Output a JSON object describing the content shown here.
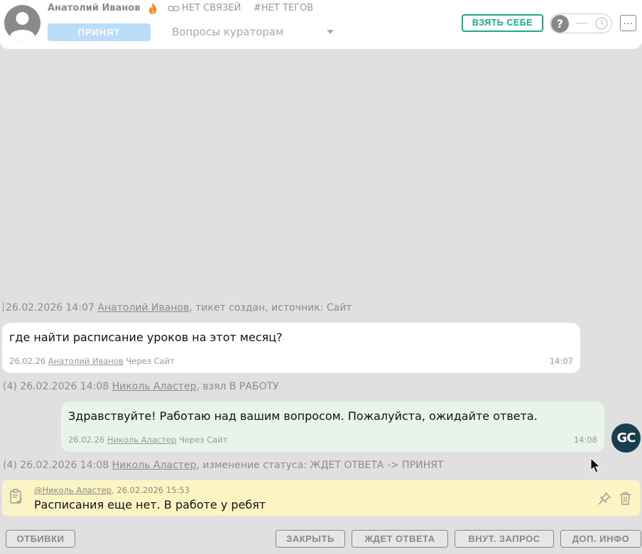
{
  "header": {
    "user_name": "Анатолий Иванов",
    "links_label": "НЕТ СВЯЗЕЙ",
    "tags_label": "#НЕТ ТЕГОВ",
    "status_label": "ПРИНЯТ",
    "queue_label": "Вопросы кураторам",
    "take_label": "ВЗЯТЬ СЕБЕ",
    "toggle_symbol": "?",
    "more_symbol": "···"
  },
  "events": [
    {
      "pre": "26.02.2026 14:07",
      "user": "Анатолий Иванов",
      "post": ", тикет создан, источник: Сайт"
    },
    {
      "pre": "(4) 26.02.2026 14:08",
      "user": "Николь Аластер",
      "post": ", взял В РАБОТУ"
    },
    {
      "pre": "(4) 26.02.2026 14:08",
      "user": "Николь Аластер",
      "post": ", изменение статуса: ЖДЕТ ОТВЕТА -> ПРИНЯТ"
    }
  ],
  "messages": [
    {
      "text": "где найти расписание уроков на этот месяц?",
      "date": "26.02.26",
      "author": "Анатолий Иванов",
      "via": "Через Сайт",
      "time": "14:07"
    },
    {
      "text": "Здравствуйте! Работаю над вашим вопросом. Пожалуйста, ожидайте ответа.",
      "date": "26.02.26",
      "author": "Николь Аластер",
      "via": "Через Сайт",
      "time": "14:08"
    }
  ],
  "agent_avatar": "GC",
  "note": {
    "author": "@Николь Аластер",
    "date": ", 26.02.2026 15:53",
    "text": "Расписания еще нет. В работе у ребят"
  },
  "footer": {
    "rejections": "ОТБИВКИ",
    "close": "ЗАКРЫТЬ",
    "waiting": "ЖДЕТ ОТВЕТА",
    "internal_request": "ВНУТ. ЗАПРОС",
    "more_info": "ДОП. ИНФО"
  },
  "colors": {
    "accent_green": "#1aab8a",
    "status_blue": "#bcdcfb",
    "note_yellow": "#fdf4c4",
    "outgoing_bubble": "#e8f3e9",
    "agent_avatar": "#173f4f"
  }
}
